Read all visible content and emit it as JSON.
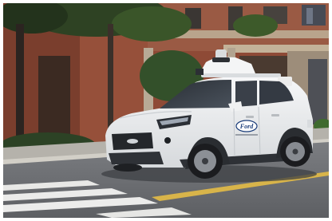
{
  "image": {
    "subject": "white-suv-self-driving-car",
    "colors": {
      "brick": "#8e4a36",
      "road": "#6d6f73",
      "car_body": "#eef0f2",
      "lane_yellow": "#d8b44a",
      "foliage": "#33502a"
    },
    "vehicle_logo": "Ford"
  }
}
